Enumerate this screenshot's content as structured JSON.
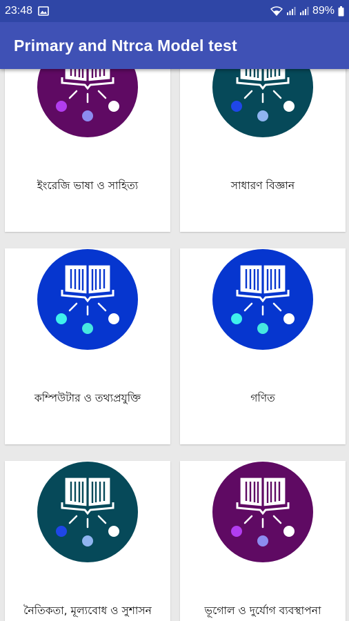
{
  "status_bar": {
    "time": "23:48",
    "battery_percent": "89%"
  },
  "app_bar": {
    "title": "Primary and Ntrca Model test"
  },
  "subjects": [
    {
      "label": "ইংরেজি ভাষা ও সাহিত্য",
      "circle_color": "#5f0a63",
      "left_dot": "#b23df0",
      "mid_dot": "#8c8cf0"
    },
    {
      "label": "সাধারণ বিজ্ঞান",
      "circle_color": "#064959",
      "left_dot": "#1f46e8",
      "mid_dot": "#8fb4f0"
    },
    {
      "label": "কম্পিউটার ও তথ্যপ্রযুক্তি",
      "circle_color": "#0636cf",
      "left_dot": "#3ff0ec",
      "mid_dot": "#46e8e0"
    },
    {
      "label": "গণিত",
      "circle_color": "#0636cf",
      "left_dot": "#3ff0ec",
      "mid_dot": "#46e8e0"
    },
    {
      "label": "নৈতিকতা, মূল্যবোধ ও সুশাসন",
      "circle_color": "#064959",
      "left_dot": "#1f46e8",
      "mid_dot": "#8fb4f0"
    },
    {
      "label": "ভূগোল ও দুর্যোগ ব্যবস্থাপনা",
      "circle_color": "#5f0a63",
      "left_dot": "#b23df0",
      "mid_dot": "#8c8cf0"
    }
  ]
}
